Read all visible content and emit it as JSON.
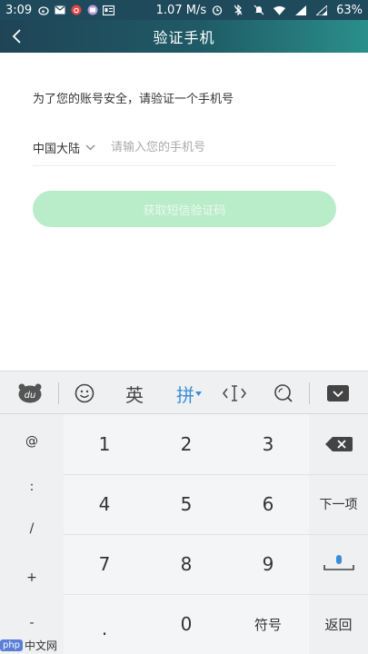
{
  "status_bar": {
    "time": "3:09",
    "speed": "1.07 M/s",
    "battery": "63%"
  },
  "header": {
    "title": "验证手机"
  },
  "main": {
    "prompt": "为了您的账号安全，请验证一个手机号",
    "country": "中国大陆",
    "phone_placeholder": "请输入您的手机号",
    "phone_value": "",
    "get_code_label": "获取短信验证码"
  },
  "keyboard_toolbar": {
    "lang_en": "英",
    "lang_pinyin": "拼"
  },
  "keyboard": {
    "symbols": [
      "@",
      ":",
      "/",
      "+",
      "-"
    ],
    "digits": [
      "1",
      "2",
      "3",
      "4",
      "5",
      "6",
      "7",
      "8",
      "9"
    ],
    "zero": "0",
    "dot": ".",
    "fuhao": "符号",
    "next": "下一项",
    "back": "返回"
  },
  "watermark": {
    "badge": "php",
    "text": "中文网"
  }
}
